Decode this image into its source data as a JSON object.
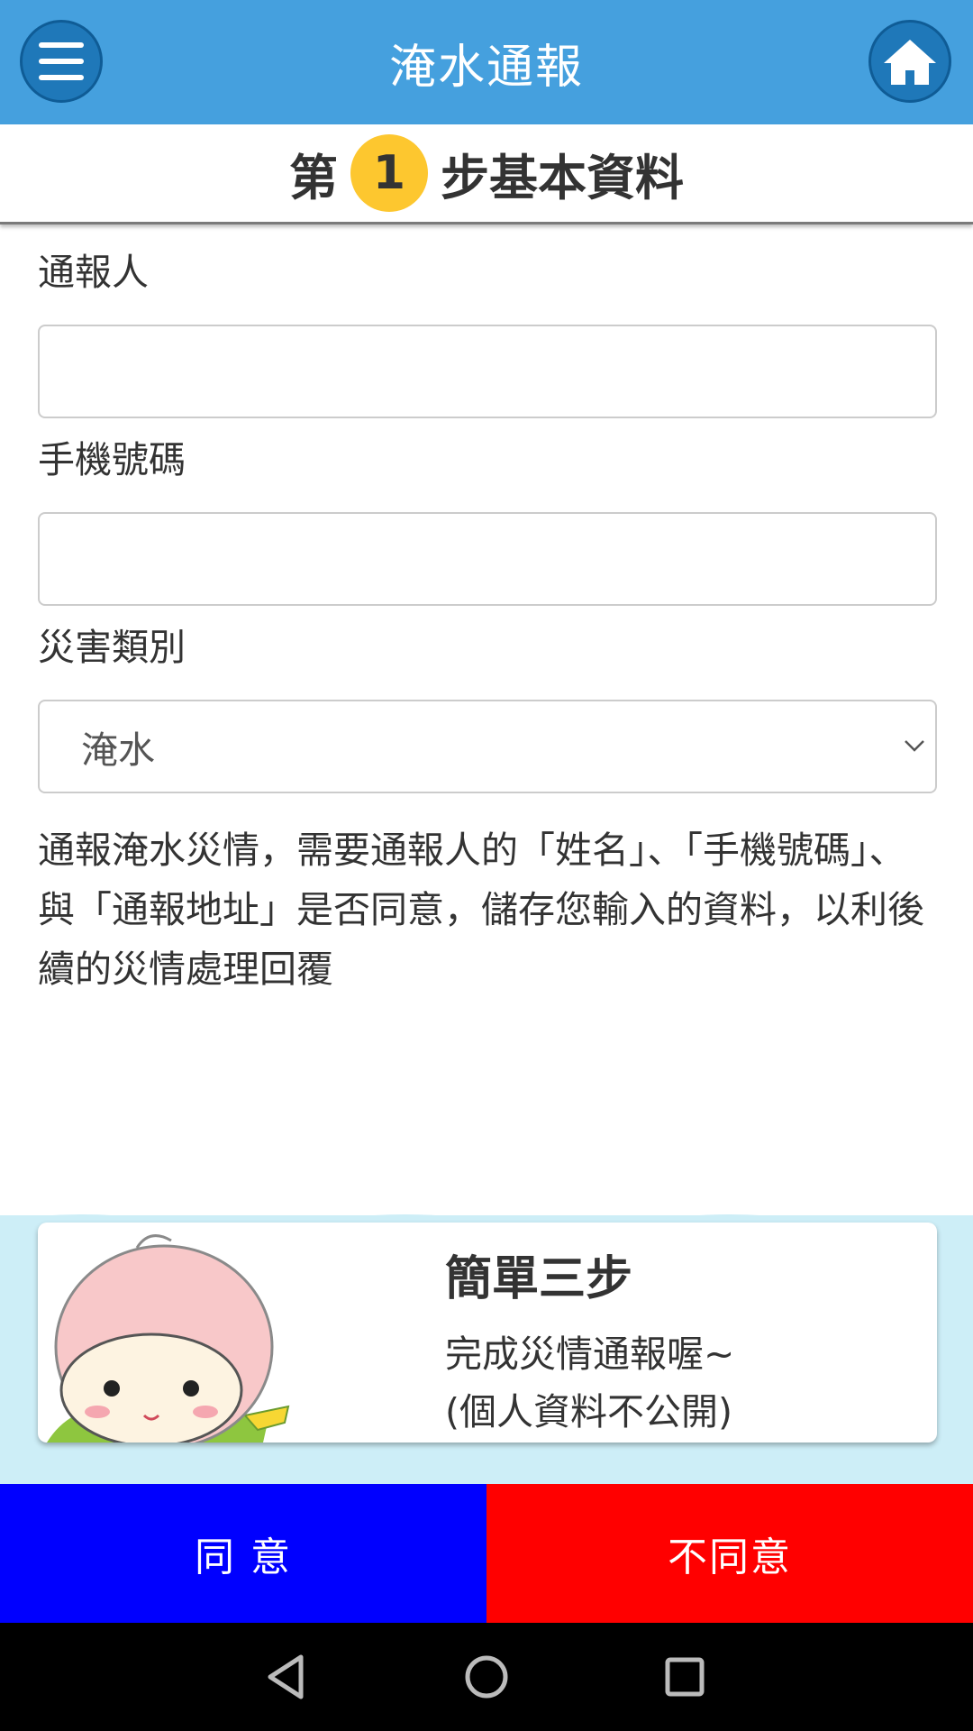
{
  "header": {
    "title": "淹水通報",
    "menu_icon": "hamburger-menu-icon",
    "home_icon": "home-icon",
    "bar_color": "#45a0de"
  },
  "step": {
    "prefix": "第",
    "number": "1",
    "suffix": "步基本資料"
  },
  "form": {
    "reporter_label": "通報人",
    "reporter_value": "",
    "phone_label": "手機號碼",
    "phone_value": "",
    "category_label": "災害類別",
    "category_value": "淹水"
  },
  "notice": "通報淹水災情，需要通報人的「姓名」、「手機號碼」、與「通報地址」是否同意，儲存您輸入的資料，以利後續的災情處理回覆",
  "banner": {
    "title": "簡單三步",
    "line1": "完成災情通報喔~",
    "line2": "(個人資料不公開)"
  },
  "actions": {
    "agree_label": "同 意",
    "agree_color": "#0000ff",
    "disagree_label": "不同意",
    "disagree_color": "#ff0000"
  },
  "system_nav": {
    "back_icon": "back-triangle-icon",
    "home_icon": "home-circle-icon",
    "recents_icon": "recents-square-icon"
  }
}
